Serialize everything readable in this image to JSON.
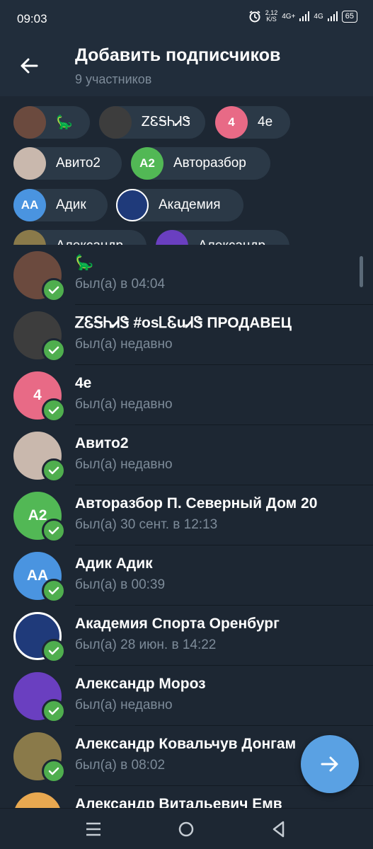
{
  "statusbar": {
    "time": "09:03",
    "speed_value": "2,12",
    "speed_unit": "K/S",
    "net1": "4G+",
    "net2": "4G",
    "battery": "65"
  },
  "header": {
    "title": "Добавить подписчиков",
    "subtitle": "9 участников"
  },
  "chips": [
    {
      "label": "🦕",
      "avatar_text": "",
      "color": "#6b4a3e"
    },
    {
      "label": "ᏃᏋᎦᏂᏗᏕ",
      "avatar_text": "",
      "color": "#3d3d3d"
    },
    {
      "label": "4е",
      "avatar_text": "4",
      "color": "#e86a86"
    },
    {
      "label": "Авито2",
      "avatar_text": "",
      "color": "#c9b8ad"
    },
    {
      "label": "Авторазбор",
      "avatar_text": "A2",
      "color": "#52b855"
    },
    {
      "label": "Адик",
      "avatar_text": "AA",
      "color": "#4a94e0"
    },
    {
      "label": "Академия",
      "avatar_text": "",
      "color": "#1f3a7a"
    },
    {
      "label": "Александр",
      "avatar_text": "",
      "color": "#8a7a4a"
    },
    {
      "label": "Александр",
      "avatar_text": "",
      "color": "#6a3fc0"
    }
  ],
  "contacts": [
    {
      "name": "🦕",
      "status": "был(а) в 04:04",
      "avatar_text": "",
      "color": "#6b4a3e"
    },
    {
      "name": "ᏃᏋᎦᏂᏗᏕ #osᏞᏋuᏗᏕ ПРОДАВЕЦ",
      "status": "был(а) недавно",
      "avatar_text": "",
      "color": "#3d3d3d"
    },
    {
      "name": "4е",
      "status": "был(а) недавно",
      "avatar_text": "4",
      "color": "#e86a86"
    },
    {
      "name": "Авито2",
      "status": "был(а) недавно",
      "avatar_text": "",
      "color": "#c9b8ad"
    },
    {
      "name": "Авторазбор П. Северный Дом 20",
      "status": "был(а) 30 сент. в 12:13",
      "avatar_text": "A2",
      "color": "#52b855"
    },
    {
      "name": "Адик Адик",
      "status": "был(а) в 00:39",
      "avatar_text": "AA",
      "color": "#4a94e0"
    },
    {
      "name": "Академия Спорта Оренбург",
      "status": "был(а) 28 июн. в 14:22",
      "avatar_text": "",
      "color": "#1f3a7a"
    },
    {
      "name": "Александр Мороз",
      "status": "был(а) недавно",
      "avatar_text": "",
      "color": "#6a3fc0"
    },
    {
      "name": "Александр Ковальчув Донгам",
      "status": "был(а) в 08:02",
      "avatar_text": "",
      "color": "#8a7a4a"
    },
    {
      "name": "Александр Витальевич Емв",
      "status": "",
      "avatar_text": "",
      "color": "#e8a850"
    }
  ],
  "colors": {
    "accent": "#5aa1e3",
    "check": "#4fae4e",
    "background": "#1d2733",
    "header": "#212d3b"
  }
}
